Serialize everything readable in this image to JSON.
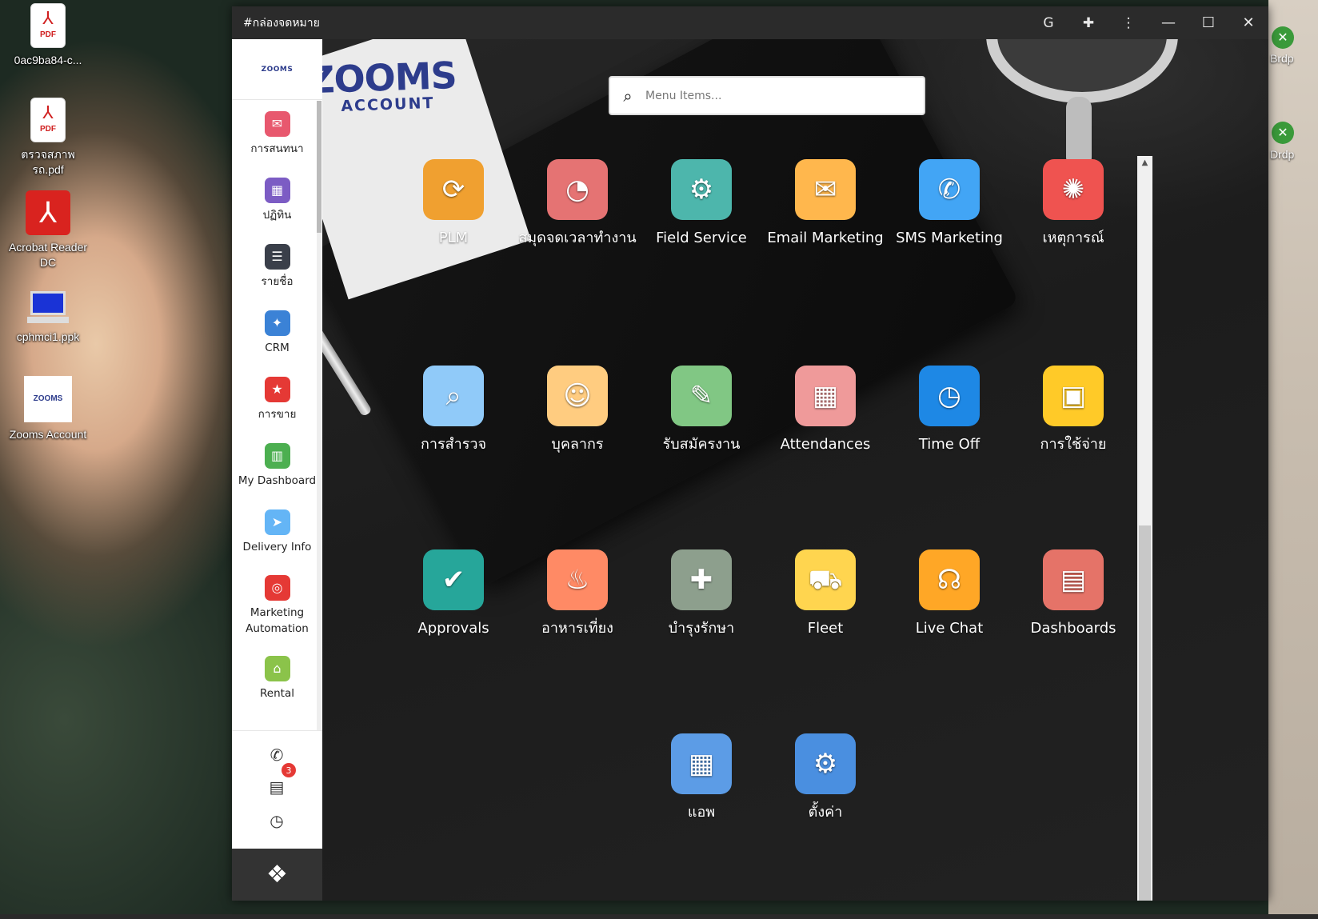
{
  "desktop": {
    "icons": [
      {
        "label": "0ac9ba84-c...",
        "type": "pdf",
        "glyph": "PDF"
      },
      {
        "label": "ตรวจสภาพรถ.pdf",
        "type": "pdf",
        "glyph": "PDF"
      },
      {
        "label": "Acrobat Reader DC",
        "type": "acrobat"
      },
      {
        "label": "cphmci1.ppk",
        "type": "computer"
      },
      {
        "label": "Zooms Account",
        "type": "zooms",
        "glyph": "ZOOMS"
      }
    ],
    "right_icons": [
      {
        "label": "Brdp"
      },
      {
        "label": "Drdp"
      }
    ]
  },
  "window": {
    "title": "#กล่องจดหมาย",
    "buttons": [
      "translate-icon",
      "extension-icon",
      "more-vert-icon",
      "minimize-icon",
      "maximize-icon",
      "close-icon"
    ]
  },
  "sidebar": {
    "logo": "ZOOMS",
    "items": [
      {
        "label": "การสนทนา",
        "icon": "chat-bubbles-icon",
        "color": "#e8586e"
      },
      {
        "label": "ปฏิทิน",
        "icon": "calendar-icon",
        "color": "#7c5cc4"
      },
      {
        "label": "รายชื่อ",
        "icon": "contacts-icon",
        "color": "#3a3f4a"
      },
      {
        "label": "CRM",
        "icon": "crm-icon",
        "color": "#3b82d6"
      },
      {
        "label": "การขาย",
        "icon": "sale-tag-icon",
        "color": "#e53935"
      },
      {
        "label": "My Dashboard",
        "icon": "dashboard-icon",
        "color": "#4caf50"
      },
      {
        "label": "Delivery Info",
        "icon": "paper-plane-icon",
        "color": "#64b5f6"
      },
      {
        "label": "Marketing Automation",
        "icon": "target-icon",
        "color": "#e53935"
      },
      {
        "label": "Rental",
        "icon": "rent-house-icon",
        "color": "#8bc34a"
      }
    ],
    "chat_badge": "3"
  },
  "main": {
    "card_brand": "ZOOMS",
    "card_sub": "ACCOUNT",
    "search_placeholder": "Menu Items...",
    "apps": [
      {
        "label": "PLM",
        "icon": "plm-cycle-icon",
        "color": "#f0a030"
      },
      {
        "label": "สมุดจดเวลาทำงาน",
        "icon": "timesheet-icon",
        "color": "#e57373"
      },
      {
        "label": "Field Service",
        "icon": "field-service-icon",
        "color": "#4db6ac"
      },
      {
        "label": "Email Marketing",
        "icon": "email-marketing-icon",
        "color": "#ffb74d"
      },
      {
        "label": "SMS Marketing",
        "icon": "sms-icon",
        "color": "#42a5f5"
      },
      {
        "label": "เหตุการณ์",
        "icon": "event-calendar-icon",
        "color": "#ef5350"
      },
      {
        "label": "การสำรวจ",
        "icon": "survey-icon",
        "color": "#90caf9"
      },
      {
        "label": "บุคลากร",
        "icon": "employees-icon",
        "color": "#ffcc80"
      },
      {
        "label": "รับสมัครงาน",
        "icon": "recruitment-icon",
        "color": "#81c784"
      },
      {
        "label": "Attendances",
        "icon": "attendance-icon",
        "color": "#ef9a9a"
      },
      {
        "label": "Time Off",
        "icon": "time-off-icon",
        "color": "#1e88e5"
      },
      {
        "label": "การใช้จ่าย",
        "icon": "expense-icon",
        "color": "#ffca28"
      },
      {
        "label": "Approvals",
        "icon": "approvals-icon",
        "color": "#26a69a"
      },
      {
        "label": "อาหารเที่ยง",
        "icon": "lunch-icon",
        "color": "#ff8a65"
      },
      {
        "label": "บำรุงรักษา",
        "icon": "maintenance-icon",
        "color": "#8d9f8d"
      },
      {
        "label": "Fleet",
        "icon": "fleet-icon",
        "color": "#ffd54f"
      },
      {
        "label": "Live Chat",
        "icon": "live-chat-icon",
        "color": "#ffa726"
      },
      {
        "label": "Dashboards",
        "icon": "dashboards-icon",
        "color": "#e57368"
      },
      {
        "label": "แอพ",
        "icon": "apps-icon",
        "color": "#5c9ce6"
      },
      {
        "label": "ตั้งค่า",
        "icon": "settings-gear-icon",
        "color": "#4a8fe0"
      }
    ]
  }
}
